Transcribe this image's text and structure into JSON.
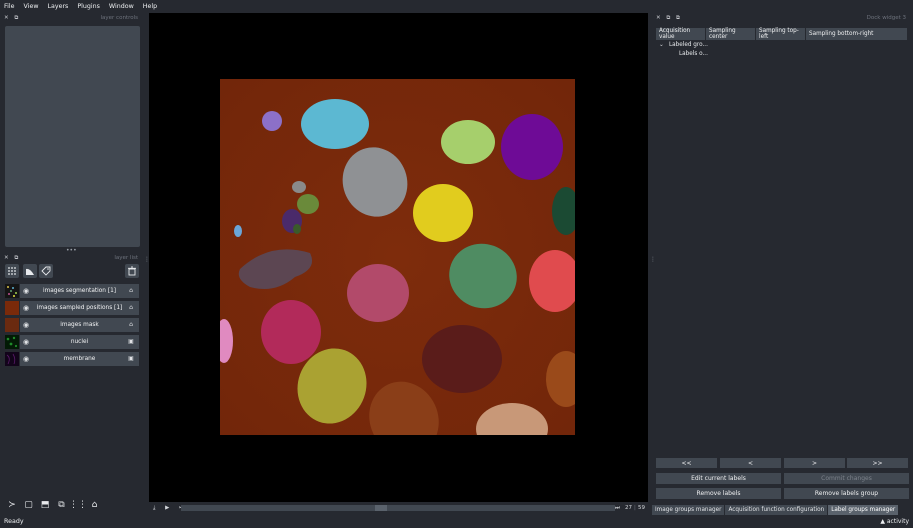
{
  "menubar": {
    "items": [
      "File",
      "View",
      "Layers",
      "Plugins",
      "Window",
      "Help"
    ]
  },
  "left_dock": {
    "controls_title": "layer controls",
    "list_title": "layer list",
    "layer_buttons": [
      {
        "icon": "points-icon"
      },
      {
        "icon": "shapes-icon"
      },
      {
        "icon": "labels-icon"
      }
    ],
    "delete_icon": "trash-icon",
    "layers": [
      {
        "name": "images segmentation [1]",
        "type_icon": "label-tag-icon",
        "thumb": "seg"
      },
      {
        "name": "images sampled positions [1]",
        "type_icon": "label-tag-icon",
        "thumb": "sampled"
      },
      {
        "name": "images mask",
        "type_icon": "label-tag-icon",
        "thumb": "mask"
      },
      {
        "name": "nuclei",
        "type_icon": "image-icon",
        "thumb": "nuclei"
      },
      {
        "name": "membrane",
        "type_icon": "image-icon",
        "thumb": "membrane"
      }
    ],
    "console_icons": [
      "console-icon",
      "square-icon",
      "cube-icon",
      "rotate-icon",
      "grid-icon",
      "home-icon"
    ]
  },
  "viewer": {
    "slider": {
      "frame": "27",
      "separator": "|",
      "total": "59",
      "position": 0.46
    }
  },
  "right_dock": {
    "title": "Dock widget 3",
    "table_headers": [
      "Acquisition value",
      "Sampling center",
      "Sampling top-left",
      "Sampling bottom-right"
    ],
    "tree": {
      "root": "Labeled gro...",
      "child": "Labels o..."
    },
    "nav_buttons": [
      "<<",
      "<",
      ">",
      ">>"
    ],
    "edit_current_labels": "Edit current labels",
    "commit_changes": "Commit changes",
    "remove_labels": "Remove labels",
    "remove_labels_group": "Remove labels group",
    "tabs": [
      "Image groups manager",
      "Acquisition function configuration",
      "Label groups manager"
    ],
    "active_tab": "Label groups manager"
  },
  "status": {
    "ready": "Ready",
    "activity": "activity"
  },
  "colors": {
    "background": "#262930",
    "panel": "#414851",
    "image_background": "#7a2a0a"
  }
}
